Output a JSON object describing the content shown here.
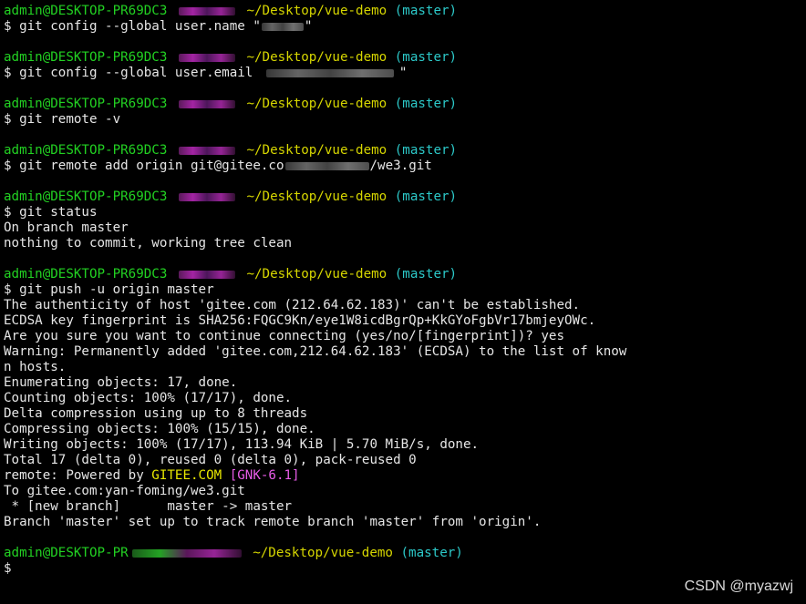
{
  "prompt": {
    "user": "admin@DESKTOP-PR69DC3",
    "path": "~/Desktop/vue-demo",
    "branch": "(master)",
    "last_user": "admin@DESKTOP-PR"
  },
  "blocks": [
    {
      "command": "$ git config --global user.name \"",
      "command_end": "\"",
      "output": []
    },
    {
      "command": "$ git config --global user.email ",
      "command_end": "\"",
      "output": []
    },
    {
      "command": "$ git remote -v",
      "command_end": "",
      "output": []
    },
    {
      "command": "$ git remote add origin git@gitee.co",
      "command_end": "/we3.git",
      "output": []
    },
    {
      "command": "$ git status",
      "command_end": "",
      "output": [
        "On branch master",
        "nothing to commit, working tree clean"
      ]
    }
  ],
  "push": {
    "command": "$ git push -u origin master",
    "output_before": [
      "The authenticity of host 'gitee.com (212.64.62.183)' can't be established.",
      "ECDSA key fingerprint is SHA256:FQGC9Kn/eye1W8icdBgrQp+KkGYoFgbVr17bmjeyOWc.",
      "Are you sure you want to continue connecting (yes/no/[fingerprint])? yes",
      "Warning: Permanently added 'gitee.com,212.64.62.183' (ECDSA) to the list of know",
      "n hosts.",
      "Enumerating objects: 17, done.",
      "Counting objects: 100% (17/17), done.",
      "Delta compression using up to 8 threads",
      "Compressing objects: 100% (15/15), done.",
      "Writing objects: 100% (17/17), 113.94 KiB | 5.70 MiB/s, done.",
      "Total 17 (delta 0), reused 0 (delta 0), pack-reused 0"
    ],
    "remote_prefix": "remote: Powered by ",
    "remote_gitee": "GITEE.COM",
    "remote_gnk": "[GNK-6.1]",
    "output_after": [
      "To gitee.com:yan-foming/we3.git",
      " * [new branch]      master -> master",
      "Branch 'master' set up to track remote branch 'master' from 'origin'."
    ]
  },
  "final_prompt": "$",
  "watermark": "CSDN @myazwj"
}
